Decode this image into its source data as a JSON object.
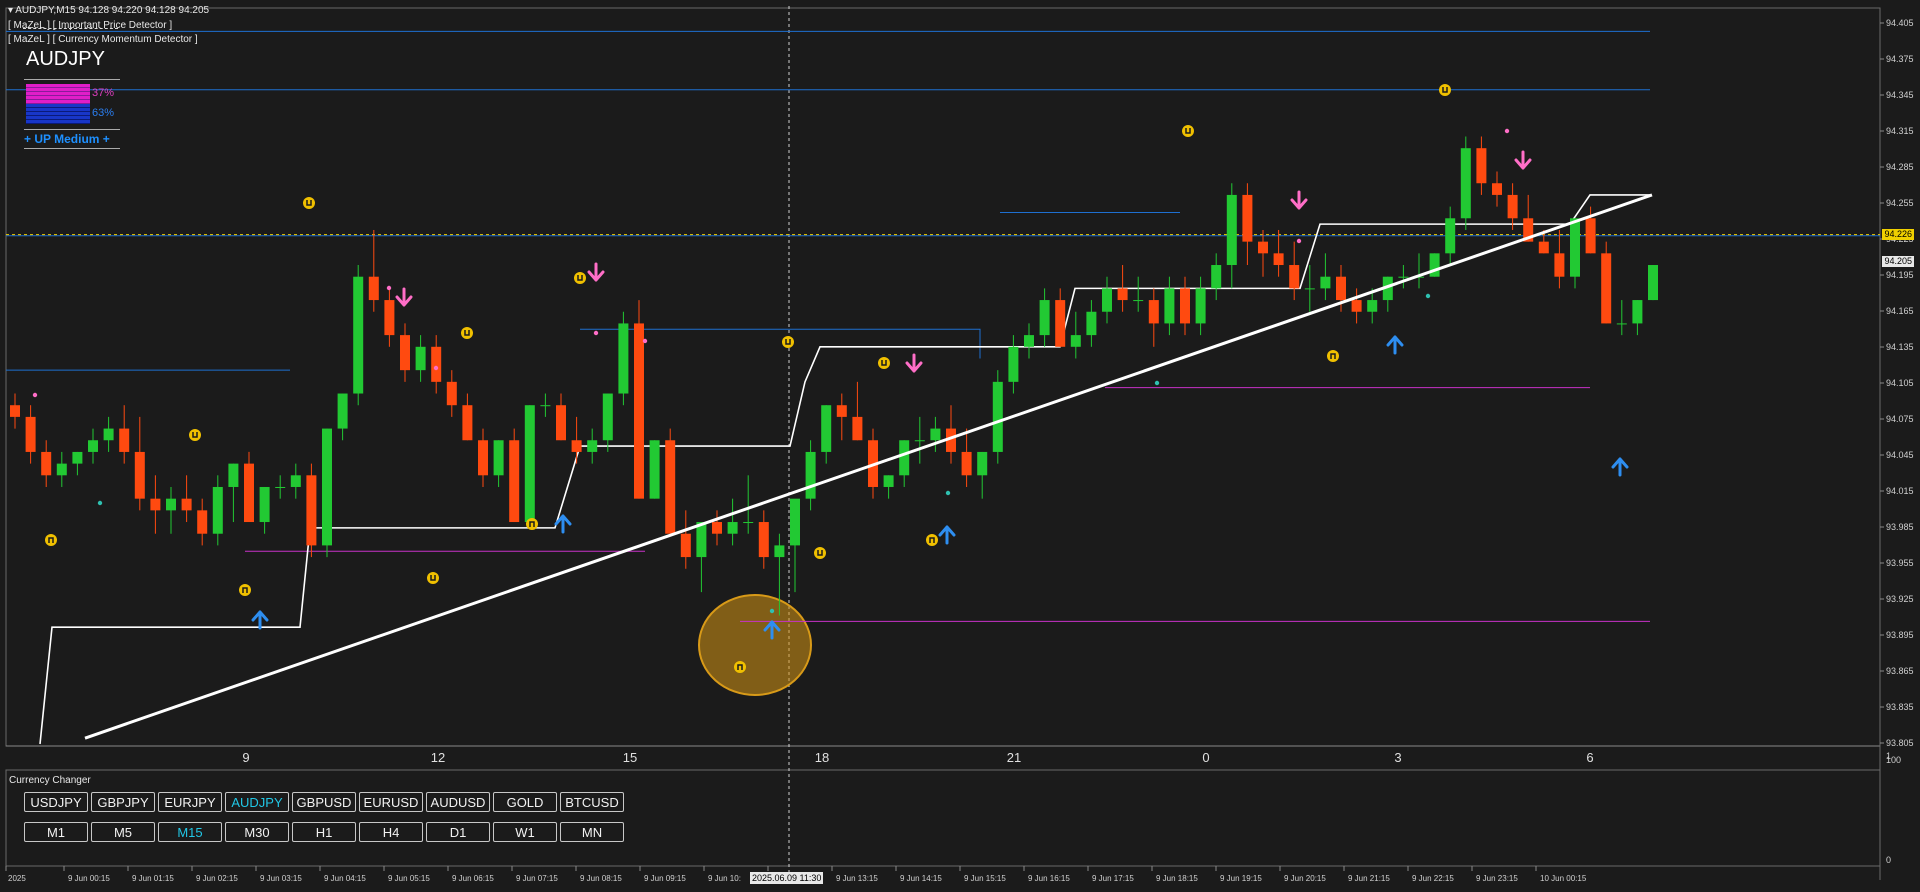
{
  "header": {
    "title": "AUDJPY,M15  94.128 94.220 94.128 94.205",
    "indicator1": "[ MaZeL ] [ Important Price Detector ]",
    "indicator2": "[ MaZeL ] [ Currency Momentum Detector ]"
  },
  "momentum": {
    "symbol": "AUDJPY",
    "pct_sell": "37%",
    "pct_buy": "63%",
    "trend": "+ UP Medium +"
  },
  "price_axis": {
    "labels": [
      "94.405",
      "94.375",
      "94.345",
      "94.315",
      "94.285",
      "94.255",
      "94.225",
      "94.195",
      "94.165",
      "94.135",
      "94.105",
      "94.075",
      "94.045",
      "94.015",
      "93.985",
      "93.955",
      "93.925",
      "93.895",
      "93.865",
      "93.835",
      "93.805"
    ],
    "current_price": "94.205",
    "bid_line_price": "94.226"
  },
  "sub_axis": {
    "labels": [
      "1",
      "100",
      "0"
    ]
  },
  "hour_labels": [
    "9",
    "12",
    "15",
    "18",
    "21",
    "0",
    "3",
    "6"
  ],
  "time_labels": [
    "2025",
    "9 Jun 00:15",
    "9 Jun 01:15",
    "9 Jun 02:15",
    "9 Jun 03:15",
    "9 Jun 04:15",
    "9 Jun 05:15",
    "9 Jun 06:15",
    "9 Jun 07:15",
    "9 Jun 08:15",
    "9 Jun 09:15",
    "9 Jun 10:",
    "9 Jun 12:15",
    "9 Jun 13:15",
    "9 Jun 14:15",
    "9 Jun 15:15",
    "9 Jun 16:15",
    "9 Jun 17:15",
    "9 Jun 18:15",
    "9 Jun 19:15",
    "9 Jun 20:15",
    "9 Jun 21:15",
    "9 Jun 22:15",
    "9 Jun 23:15",
    "10 Jun 00:15"
  ],
  "crosshair_time": "2025.06.09 11:30",
  "panel": {
    "title": "Currency Changer",
    "symbols": [
      "USDJPY",
      "GBPJPY",
      "EURJPY",
      "AUDJPY",
      "GBPUSD",
      "EURUSD",
      "AUDUSD",
      "GOLD",
      "BTCUSD"
    ],
    "selected_symbol": "AUDJPY",
    "timeframes": [
      "M1",
      "M5",
      "M15",
      "M30",
      "H1",
      "H4",
      "D1",
      "W1",
      "MN"
    ],
    "selected_timeframe": "M15"
  },
  "colors": {
    "background": "#1b1b1b",
    "bull": "#22c933",
    "bear": "#ff4a10",
    "blue_line": "#1e6fd0",
    "magenta_line": "#c832c8",
    "selected": "#21c7e6",
    "bid_line": "#f0d000",
    "arrow_up": "#2e8ef0",
    "arrow_down": "#ff6ec7",
    "signal": "#f0c000"
  },
  "chart_data": {
    "type": "candlestick",
    "symbol": "AUDJPY",
    "timeframe": "M15",
    "ylim": [
      93.79,
      94.42
    ],
    "candles": [
      [
        94.08,
        94.09,
        94.06,
        94.07
      ],
      [
        94.07,
        94.08,
        94.03,
        94.04
      ],
      [
        94.04,
        94.05,
        94.01,
        94.02
      ],
      [
        94.02,
        94.04,
        94.01,
        94.03
      ],
      [
        94.03,
        94.04,
        94.02,
        94.04
      ],
      [
        94.04,
        94.06,
        94.03,
        94.05
      ],
      [
        94.05,
        94.07,
        94.04,
        94.06
      ],
      [
        94.06,
        94.08,
        94.03,
        94.04
      ],
      [
        94.04,
        94.07,
        93.99,
        94.0
      ],
      [
        94.0,
        94.02,
        93.97,
        93.99
      ],
      [
        93.99,
        94.01,
        93.97,
        94.0
      ],
      [
        94.0,
        94.02,
        93.98,
        93.99
      ],
      [
        93.99,
        94.0,
        93.96,
        93.97
      ],
      [
        93.97,
        94.02,
        93.96,
        94.01
      ],
      [
        94.01,
        94.03,
        93.98,
        94.03
      ],
      [
        94.03,
        94.04,
        93.98,
        93.98
      ],
      [
        93.98,
        94.01,
        93.97,
        94.01
      ],
      [
        94.01,
        94.02,
        94.0,
        94.01
      ],
      [
        94.01,
        94.03,
        94.0,
        94.02
      ],
      [
        94.02,
        94.03,
        93.95,
        93.96
      ],
      [
        93.96,
        94.06,
        93.95,
        94.06
      ],
      [
        94.06,
        94.09,
        94.05,
        94.09
      ],
      [
        94.09,
        94.2,
        94.08,
        94.19
      ],
      [
        94.19,
        94.23,
        94.16,
        94.17
      ],
      [
        94.17,
        94.18,
        94.13,
        94.14
      ],
      [
        94.14,
        94.15,
        94.1,
        94.11
      ],
      [
        94.11,
        94.14,
        94.1,
        94.13
      ],
      [
        94.13,
        94.14,
        94.09,
        94.1
      ],
      [
        94.1,
        94.11,
        94.07,
        94.08
      ],
      [
        94.08,
        94.09,
        94.05,
        94.05
      ],
      [
        94.05,
        94.06,
        94.01,
        94.02
      ],
      [
        94.02,
        94.05,
        94.01,
        94.05
      ],
      [
        94.05,
        94.06,
        93.98,
        93.98
      ],
      [
        93.98,
        94.08,
        93.98,
        94.08
      ],
      [
        94.08,
        94.09,
        94.07,
        94.08
      ],
      [
        94.08,
        94.09,
        94.05,
        94.05
      ],
      [
        94.05,
        94.07,
        94.03,
        94.04
      ],
      [
        94.04,
        94.06,
        94.03,
        94.05
      ],
      [
        94.05,
        94.09,
        94.04,
        94.09
      ],
      [
        94.09,
        94.16,
        94.08,
        94.15
      ],
      [
        94.15,
        94.17,
        94.0,
        94.0
      ],
      [
        94.0,
        94.05,
        94.0,
        94.05
      ],
      [
        94.05,
        94.06,
        93.97,
        93.97
      ],
      [
        93.97,
        93.99,
        93.94,
        93.95
      ],
      [
        93.95,
        93.98,
        93.92,
        93.98
      ],
      [
        93.98,
        93.99,
        93.96,
        93.97
      ],
      [
        93.97,
        94.0,
        93.96,
        93.98
      ],
      [
        93.98,
        94.02,
        93.97,
        93.98
      ],
      [
        93.98,
        93.99,
        93.94,
        93.95
      ],
      [
        93.95,
        93.97,
        93.9,
        93.96
      ],
      [
        93.96,
        93.98,
        93.92,
        94.0
      ],
      [
        94.0,
        94.05,
        93.99,
        94.04
      ],
      [
        94.04,
        94.08,
        94.03,
        94.08
      ],
      [
        94.08,
        94.09,
        94.05,
        94.07
      ],
      [
        94.07,
        94.1,
        94.05,
        94.05
      ],
      [
        94.05,
        94.06,
        94.0,
        94.01
      ],
      [
        94.01,
        94.02,
        94.0,
        94.02
      ],
      [
        94.02,
        94.05,
        94.01,
        94.05
      ],
      [
        94.05,
        94.07,
        94.03,
        94.05
      ],
      [
        94.05,
        94.07,
        94.04,
        94.06
      ],
      [
        94.06,
        94.08,
        94.03,
        94.04
      ],
      [
        94.04,
        94.06,
        94.01,
        94.02
      ],
      [
        94.02,
        94.04,
        94.0,
        94.04
      ],
      [
        94.04,
        94.11,
        94.03,
        94.1
      ],
      [
        94.1,
        94.14,
        94.09,
        94.13
      ],
      [
        94.13,
        94.15,
        94.12,
        94.14
      ],
      [
        94.14,
        94.18,
        94.13,
        94.17
      ],
      [
        94.17,
        94.18,
        94.13,
        94.13
      ],
      [
        94.13,
        94.16,
        94.12,
        94.14
      ],
      [
        94.14,
        94.17,
        94.13,
        94.16
      ],
      [
        94.16,
        94.19,
        94.15,
        94.18
      ],
      [
        94.18,
        94.2,
        94.16,
        94.17
      ],
      [
        94.17,
        94.19,
        94.16,
        94.17
      ],
      [
        94.17,
        94.18,
        94.13,
        94.15
      ],
      [
        94.15,
        94.19,
        94.14,
        94.18
      ],
      [
        94.18,
        94.19,
        94.14,
        94.15
      ],
      [
        94.15,
        94.19,
        94.14,
        94.18
      ],
      [
        94.18,
        94.21,
        94.17,
        94.2
      ],
      [
        94.2,
        94.27,
        94.18,
        94.26
      ],
      [
        94.26,
        94.27,
        94.2,
        94.22
      ],
      [
        94.22,
        94.23,
        94.19,
        94.21
      ],
      [
        94.21,
        94.23,
        94.19,
        94.2
      ],
      [
        94.2,
        94.22,
        94.17,
        94.18
      ],
      [
        94.18,
        94.2,
        94.16,
        94.18
      ],
      [
        94.18,
        94.21,
        94.17,
        94.19
      ],
      [
        94.19,
        94.2,
        94.16,
        94.17
      ],
      [
        94.17,
        94.18,
        94.15,
        94.16
      ],
      [
        94.16,
        94.18,
        94.15,
        94.17
      ],
      [
        94.17,
        94.19,
        94.16,
        94.19
      ],
      [
        94.19,
        94.2,
        94.18,
        94.19
      ],
      [
        94.19,
        94.21,
        94.18,
        94.19
      ],
      [
        94.19,
        94.21,
        94.19,
        94.21
      ],
      [
        94.21,
        94.25,
        94.2,
        94.24
      ],
      [
        94.24,
        94.31,
        94.23,
        94.3
      ],
      [
        94.3,
        94.31,
        94.26,
        94.27
      ],
      [
        94.27,
        94.28,
        94.25,
        94.26
      ],
      [
        94.26,
        94.27,
        94.23,
        94.24
      ],
      [
        94.24,
        94.26,
        94.22,
        94.22
      ],
      [
        94.22,
        94.23,
        94.21,
        94.21
      ],
      [
        94.21,
        94.23,
        94.18,
        94.19
      ],
      [
        94.19,
        94.24,
        94.18,
        94.24
      ],
      [
        94.24,
        94.25,
        94.21,
        94.21
      ],
      [
        94.21,
        94.22,
        94.15,
        94.15
      ],
      [
        94.15,
        94.17,
        94.14,
        94.15
      ],
      [
        94.15,
        94.17,
        94.14,
        94.17
      ],
      [
        94.17,
        94.2,
        94.17,
        94.2
      ]
    ],
    "horizontal_levels": [
      {
        "price": 94.4,
        "color": "blue"
      },
      {
        "price": 94.35,
        "color": "blue"
      },
      {
        "price": 94.225,
        "color": "blue"
      },
      {
        "price": 94.11,
        "color": "blue"
      },
      {
        "price": 93.955,
        "color": "magenta"
      },
      {
        "price": 93.895,
        "color": "magenta"
      },
      {
        "price": 94.095,
        "color": "magenta"
      }
    ]
  }
}
